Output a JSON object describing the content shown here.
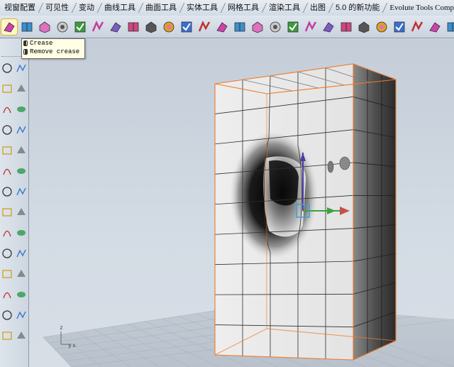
{
  "tabs": [
    {
      "label": "视窗配置"
    },
    {
      "label": "可见性"
    },
    {
      "label": "变动"
    },
    {
      "label": "曲线工具"
    },
    {
      "label": "曲面工具"
    },
    {
      "label": "实体工具"
    },
    {
      "label": "网格工具"
    },
    {
      "label": "渲染工具"
    },
    {
      "label": "出图"
    },
    {
      "label": "5.0 的新功能"
    },
    {
      "label": "Evolute Tools Comp"
    }
  ],
  "toolbar": {
    "icons": [
      "crease-tool-icon",
      "mesh-box-icon",
      "subd-box-icon",
      "surface-icon",
      "face-icon",
      "edge-icon",
      "grid-icon",
      "mirror-icon",
      "delete-mesh-icon",
      "weld-icon",
      "bridge-icon",
      "flip-icon",
      "extrude-icon",
      "pattern-icon",
      "smooth-icon",
      "pointer-icon",
      "fill-icon",
      "split-icon",
      "arrow-icon",
      "mesh-edit-icon",
      "shape-icon",
      "sun-icon",
      "pentagon-icon",
      "heat-icon",
      "wave-icon",
      "gear-icon"
    ]
  },
  "tooltip": {
    "items": [
      "Crease",
      "Remove crease"
    ]
  },
  "viewport": {
    "axis_labels": {
      "z": "z",
      "y": "y",
      "x": "x"
    }
  },
  "colors": {
    "accent_orange": "#f07a2a",
    "mesh_line": "#3a3a3a",
    "viewport_bg": "#c8d1dc"
  }
}
